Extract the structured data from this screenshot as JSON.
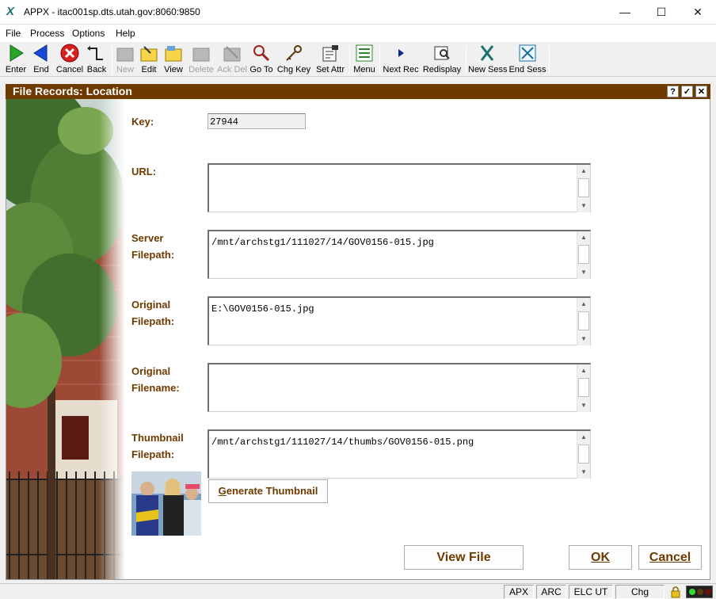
{
  "window": {
    "title": "APPX - itac001sp.dts.utah.gov:8060:9850",
    "app_icon": "appx-x-icon",
    "controls": {
      "minimize": "—",
      "maximize": "☐",
      "close": "✕"
    }
  },
  "menu": {
    "items": [
      "File",
      "Process",
      "Options",
      "Help"
    ]
  },
  "toolbar": {
    "buttons": [
      {
        "label": "Enter",
        "icon": "enter-green-arrow-icon",
        "enabled": true
      },
      {
        "label": "End",
        "icon": "end-blue-arrow-icon",
        "enabled": true
      },
      {
        "label": "Cancel",
        "icon": "cancel-red-x-icon",
        "enabled": true
      },
      {
        "label": "Back",
        "icon": "back-arrow-icon",
        "enabled": true
      },
      {
        "label": "New",
        "icon": "new-record-icon",
        "enabled": false
      },
      {
        "label": "Edit",
        "icon": "edit-folder-icon",
        "enabled": true
      },
      {
        "label": "View",
        "icon": "view-folder-icon",
        "enabled": true
      },
      {
        "label": "Delete",
        "icon": "delete-icon",
        "enabled": false
      },
      {
        "label": "Ack Del",
        "icon": "ack-delete-icon",
        "enabled": false
      },
      {
        "label": "Go To",
        "icon": "magnifier-icon",
        "enabled": true
      },
      {
        "label": "Chg Key",
        "icon": "key-icon",
        "enabled": true
      },
      {
        "label": "Set Attr",
        "icon": "set-attributes-icon",
        "enabled": true
      },
      {
        "label": "Menu",
        "icon": "menu-list-icon",
        "enabled": true
      },
      {
        "label": "Next Rec",
        "icon": "next-record-icon",
        "enabled": true
      },
      {
        "label": "Redisplay",
        "icon": "redisplay-icon",
        "enabled": true
      },
      {
        "label": "New Sess",
        "icon": "new-session-icon",
        "enabled": true
      },
      {
        "label": "End Sess",
        "icon": "end-session-icon",
        "enabled": true
      }
    ]
  },
  "form": {
    "title": "File Records:  Location",
    "header_buttons": {
      "help": "?",
      "confirm": "✓",
      "close": "✕"
    },
    "key": {
      "label": "Key:",
      "value": "27944"
    },
    "url": {
      "label": "URL:",
      "value": ""
    },
    "server_filepath": {
      "label_line1": "Server",
      "label_line2": "Filepath:",
      "value": "/mnt/archstg1/111027/14/GOV0156-015.jpg"
    },
    "original_filepath": {
      "label_line1": "Original",
      "label_line2": "Filepath:",
      "value": "E:\\GOV0156-015.jpg"
    },
    "original_filename": {
      "label_line1": "Original",
      "label_line2": "Filename:",
      "value": ""
    },
    "thumbnail_filepath": {
      "label_line1": "Thumbnail",
      "label_line2": "Filepath:",
      "value": "/mnt/archstg1/111027/14/thumbs/GOV0156-015.png"
    },
    "generate_thumbnail": {
      "mnemonic": "G",
      "rest": "enerate Thumbnail"
    },
    "view_file": "View File",
    "ok": "OK",
    "cancel": "Cancel"
  },
  "status": {
    "cells": [
      "APX",
      "ARC",
      "ELC UT",
      "Chg"
    ]
  },
  "colors": {
    "accent": "#6e3a00",
    "header_bg": "#6e3a00"
  }
}
